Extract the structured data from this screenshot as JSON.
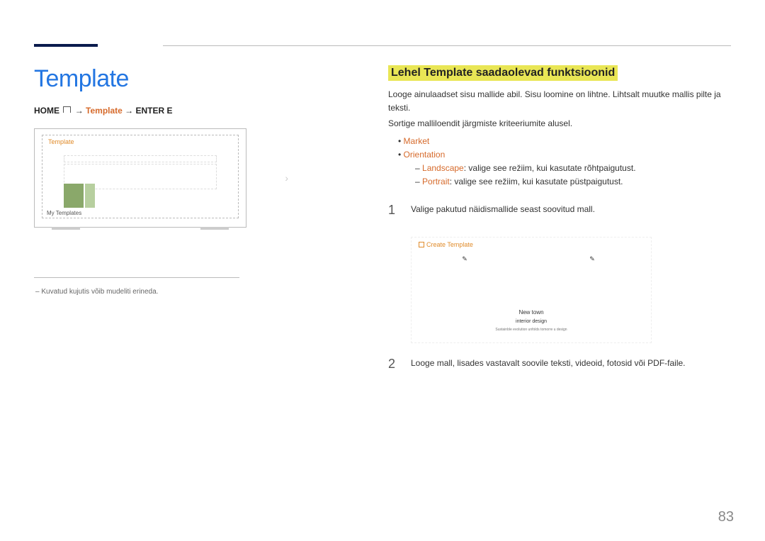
{
  "page_number": "83",
  "left": {
    "title": "Template",
    "breadcrumb": {
      "home": "HOME",
      "template": "Template",
      "enter": "ENTER E"
    },
    "tv": {
      "label": "Template",
      "my_templates": "My Templates"
    },
    "note": "Kuvatud kujutis võib mudeliti erineda."
  },
  "right": {
    "heading": "Lehel Template saadaolevad funktsioonid",
    "intro1": "Looge ainulaadset sisu mallide abil. Sisu loomine on lihtne. Lihtsalt muutke mallis pilte ja teksti.",
    "intro2": "Sortige malliloendit järgmiste kriteeriumite alusel.",
    "bullets": {
      "market": "Market",
      "orientation": "Orientation",
      "landscape_label": "Landscape",
      "landscape_text": ": valige see režiim, kui kasutate rõhtpaigutust.",
      "portrait_label": "Portrait",
      "portrait_text": ": valige see režiim, kui kasutate püstpaigutust."
    },
    "steps": {
      "s1_num": "1",
      "s1_text": "Valige pakutud näidismallide seast soovitud mall.",
      "s2_num": "2",
      "s2_text": "Looge mall, lisades vastavalt soovile teksti, videoid, fotosid või PDF-faile."
    },
    "preview": {
      "create_label": "Create Template",
      "t1": "New town",
      "t2": "interior design",
      "t3": "Sustainble evolution unfolds tomorre u design"
    }
  }
}
